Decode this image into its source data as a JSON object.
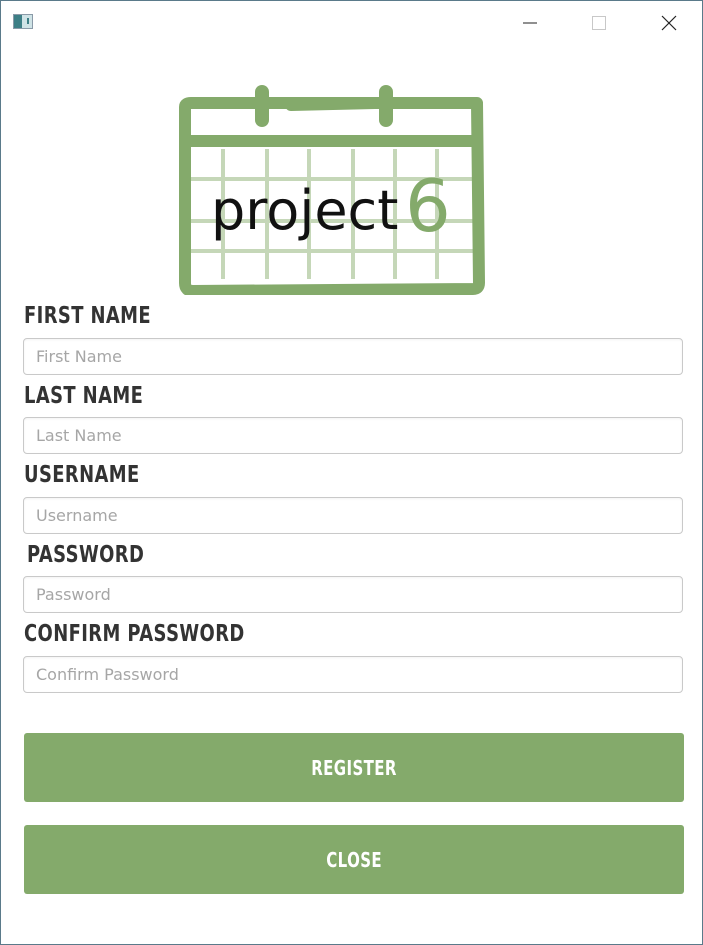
{
  "window": {
    "icon": "app-window-icon",
    "controls": {
      "minimize": "minimize-icon",
      "maximize": "maximize-icon",
      "close": "close-icon"
    }
  },
  "logo": {
    "text_main": "project",
    "text_accent": "6",
    "icon": "calendar-icon",
    "accent_color": "#84aa6b"
  },
  "form": {
    "first_name": {
      "label": "FIRST NAME",
      "placeholder": "First Name",
      "value": ""
    },
    "last_name": {
      "label": "LAST NAME",
      "placeholder": "Last Name",
      "value": ""
    },
    "username": {
      "label": "USERNAME",
      "placeholder": "Username",
      "value": ""
    },
    "password": {
      "label": "PASSWORD",
      "placeholder": "Password",
      "value": ""
    },
    "confirm_password": {
      "label": "CONFIRM PASSWORD",
      "placeholder": "Confirm Password",
      "value": ""
    }
  },
  "buttons": {
    "register": "REGISTER",
    "close": "CLOSE",
    "color": "#84aa6b"
  }
}
